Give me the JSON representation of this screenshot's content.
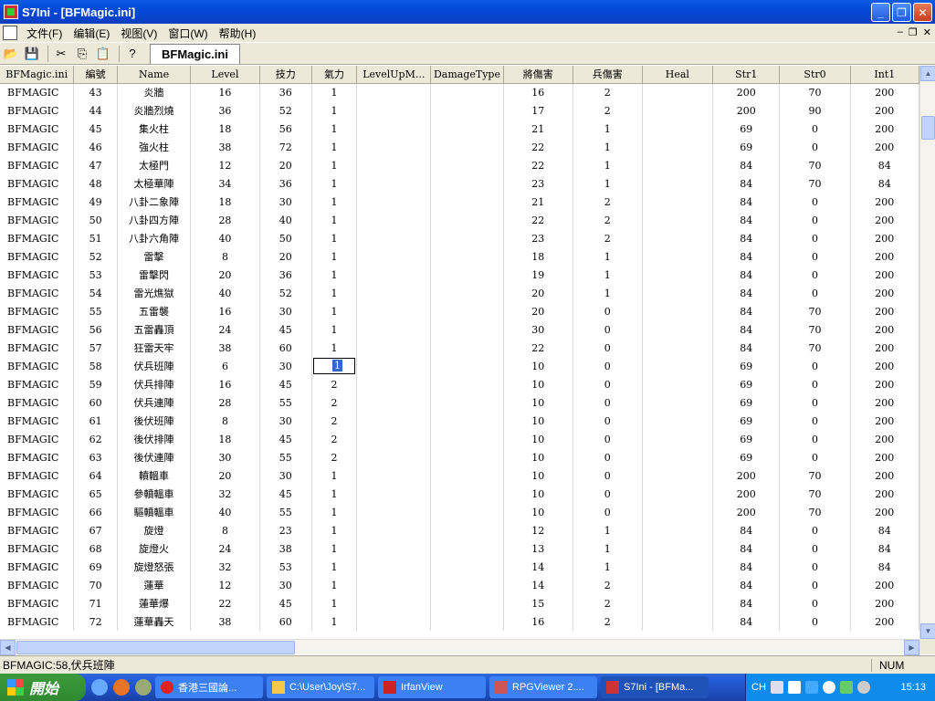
{
  "window": {
    "title": "S7Ini - [BFMagic.ini]"
  },
  "menu": [
    "文件(F)",
    "编辑(E)",
    "视图(V)",
    "窗口(W)",
    "帮助(H)"
  ],
  "toolbar": {
    "tab_label": "BFMagic.ini"
  },
  "table": {
    "columns": [
      "BFMagic.ini",
      "編號",
      "Name",
      "Level",
      "技力",
      "氣力",
      "LevelUpM...",
      "DamageType",
      "將傷害",
      "兵傷害",
      "Heal",
      "Str1",
      "Str0",
      "Int1"
    ],
    "rows": [
      [
        "BFMAGIC",
        "43",
        "炎牆",
        "16",
        "36",
        "1",
        "",
        "",
        "16",
        "2",
        "",
        "200",
        "70",
        "200"
      ],
      [
        "BFMAGIC",
        "44",
        "炎牆烈燒",
        "36",
        "52",
        "1",
        "",
        "",
        "17",
        "2",
        "",
        "200",
        "90",
        "200"
      ],
      [
        "BFMAGIC",
        "45",
        "集火柱",
        "18",
        "56",
        "1",
        "",
        "",
        "21",
        "1",
        "",
        "69",
        "0",
        "200"
      ],
      [
        "BFMAGIC",
        "46",
        "強火柱",
        "38",
        "72",
        "1",
        "",
        "",
        "22",
        "1",
        "",
        "69",
        "0",
        "200"
      ],
      [
        "BFMAGIC",
        "47",
        "太極門",
        "12",
        "20",
        "1",
        "",
        "",
        "22",
        "1",
        "",
        "84",
        "70",
        "84"
      ],
      [
        "BFMAGIC",
        "48",
        "太極華陣",
        "34",
        "36",
        "1",
        "",
        "",
        "23",
        "1",
        "",
        "84",
        "70",
        "84"
      ],
      [
        "BFMAGIC",
        "49",
        "八卦二象陣",
        "18",
        "30",
        "1",
        "",
        "",
        "21",
        "2",
        "",
        "84",
        "0",
        "200"
      ],
      [
        "BFMAGIC",
        "50",
        "八卦四方陣",
        "28",
        "40",
        "1",
        "",
        "",
        "22",
        "2",
        "",
        "84",
        "0",
        "200"
      ],
      [
        "BFMAGIC",
        "51",
        "八卦六角陣",
        "40",
        "50",
        "1",
        "",
        "",
        "23",
        "2",
        "",
        "84",
        "0",
        "200"
      ],
      [
        "BFMAGIC",
        "52",
        "雷擊",
        "8",
        "20",
        "1",
        "",
        "",
        "18",
        "1",
        "",
        "84",
        "0",
        "200"
      ],
      [
        "BFMAGIC",
        "53",
        "雷擊閃",
        "20",
        "36",
        "1",
        "",
        "",
        "19",
        "1",
        "",
        "84",
        "0",
        "200"
      ],
      [
        "BFMAGIC",
        "54",
        "雷光燋獄",
        "40",
        "52",
        "1",
        "",
        "",
        "20",
        "1",
        "",
        "84",
        "0",
        "200"
      ],
      [
        "BFMAGIC",
        "55",
        "五雷襲",
        "16",
        "30",
        "1",
        "",
        "",
        "20",
        "0",
        "",
        "84",
        "70",
        "200"
      ],
      [
        "BFMAGIC",
        "56",
        "五雷轟頂",
        "24",
        "45",
        "1",
        "",
        "",
        "30",
        "0",
        "",
        "84",
        "70",
        "200"
      ],
      [
        "BFMAGIC",
        "57",
        "狂雷天牢",
        "38",
        "60",
        "1",
        "",
        "",
        "22",
        "0",
        "",
        "84",
        "70",
        "200"
      ],
      [
        "BFMAGIC",
        "58",
        "伏兵班陣",
        "6",
        "30",
        "1",
        "",
        "",
        "10",
        "0",
        "",
        "69",
        "0",
        "200"
      ],
      [
        "BFMAGIC",
        "59",
        "伏兵排陣",
        "16",
        "45",
        "2",
        "",
        "",
        "10",
        "0",
        "",
        "69",
        "0",
        "200"
      ],
      [
        "BFMAGIC",
        "60",
        "伏兵連陣",
        "28",
        "55",
        "2",
        "",
        "",
        "10",
        "0",
        "",
        "69",
        "0",
        "200"
      ],
      [
        "BFMAGIC",
        "61",
        "後伏班陣",
        "8",
        "30",
        "2",
        "",
        "",
        "10",
        "0",
        "",
        "69",
        "0",
        "200"
      ],
      [
        "BFMAGIC",
        "62",
        "後伏排陣",
        "18",
        "45",
        "2",
        "",
        "",
        "10",
        "0",
        "",
        "69",
        "0",
        "200"
      ],
      [
        "BFMAGIC",
        "63",
        "後伏連陣",
        "30",
        "55",
        "2",
        "",
        "",
        "10",
        "0",
        "",
        "69",
        "0",
        "200"
      ],
      [
        "BFMAGIC",
        "64",
        "轒轀車",
        "20",
        "30",
        "1",
        "",
        "",
        "10",
        "0",
        "",
        "200",
        "70",
        "200"
      ],
      [
        "BFMAGIC",
        "65",
        "參轒轀車",
        "32",
        "45",
        "1",
        "",
        "",
        "10",
        "0",
        "",
        "200",
        "70",
        "200"
      ],
      [
        "BFMAGIC",
        "66",
        "驅轒轀車",
        "40",
        "55",
        "1",
        "",
        "",
        "10",
        "0",
        "",
        "200",
        "70",
        "200"
      ],
      [
        "BFMAGIC",
        "67",
        "旋燈",
        "8",
        "23",
        "1",
        "",
        "",
        "12",
        "1",
        "",
        "84",
        "0",
        "84"
      ],
      [
        "BFMAGIC",
        "68",
        "旋燈火",
        "24",
        "38",
        "1",
        "",
        "",
        "13",
        "1",
        "",
        "84",
        "0",
        "84"
      ],
      [
        "BFMAGIC",
        "69",
        "旋燈怒張",
        "32",
        "53",
        "1",
        "",
        "",
        "14",
        "1",
        "",
        "84",
        "0",
        "84"
      ],
      [
        "BFMAGIC",
        "70",
        "蓮華",
        "12",
        "30",
        "1",
        "",
        "",
        "14",
        "2",
        "",
        "84",
        "0",
        "200"
      ],
      [
        "BFMAGIC",
        "71",
        "蓮華爆",
        "22",
        "45",
        "1",
        "",
        "",
        "15",
        "2",
        "",
        "84",
        "0",
        "200"
      ],
      [
        "BFMAGIC",
        "72",
        "蓮華轟天",
        "38",
        "60",
        "1",
        "",
        "",
        "16",
        "2",
        "",
        "84",
        "0",
        "200"
      ]
    ]
  },
  "status": {
    "message": "BFMAGIC:58,伏兵班陣",
    "num": "NUM"
  },
  "taskbar": {
    "start_label": "開始",
    "tasks": [
      "香港三國論...",
      "C:\\User\\Joy\\S7...",
      "IrfanView",
      "RPGViewer 2....",
      "S7Ini - [BFMa..."
    ],
    "tray_lang": "CH",
    "clock": "15:13"
  },
  "colors": {
    "selection": "#316ac5",
    "titlebar": "#0a5ce6",
    "taskbar": "#245edb",
    "start": "#3c9a3c"
  }
}
